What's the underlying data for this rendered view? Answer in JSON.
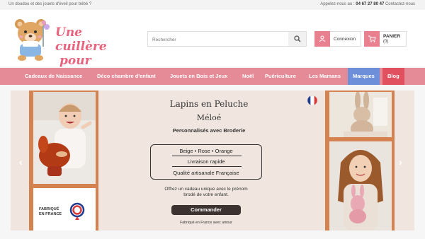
{
  "topbar": {
    "tagline": "Un doudou et des jouets d'éveil pour bébé ?",
    "call_label": "Appelez-nous au :",
    "phone": "04 67 27 80 47",
    "contact": "Contactez-nous"
  },
  "logo": {
    "line1": "Une cuillère",
    "line2": "pour doudou !"
  },
  "search": {
    "placeholder": "Rechercher",
    "icon": "search-icon"
  },
  "login": {
    "label": "Connexion",
    "icon": "user-icon"
  },
  "cart": {
    "label": "PANIER",
    "count": "(0)",
    "icon": "cart-icon"
  },
  "nav": {
    "items": [
      {
        "label": "Cadeaux de Naissance"
      },
      {
        "label": "Déco chambre d'enfant"
      },
      {
        "label": "Jouets en Bois et Jeux"
      },
      {
        "label": "Noël"
      },
      {
        "label": "Puériculture"
      },
      {
        "label": "Les Mamans"
      },
      {
        "label": "Marques"
      },
      {
        "label": "Blog"
      }
    ]
  },
  "hero": {
    "title": "Lapins en Peluche",
    "subtitle": "Méloé",
    "tagline": "Personnalisés avec Broderie",
    "features": [
      "Beige • Rose • Orange",
      "Livraison rapide",
      "Qualité artisanale Française"
    ],
    "desc_line1": "Offrez un cadeau unique avec le prénom",
    "desc_line2": "brodé de votre enfant.",
    "cta": "Commander",
    "footer": "Fabriqué en France avec amour",
    "badge_line1": "FABRIQUÉ",
    "badge_line2": "EN FRANCE",
    "prev": "‹",
    "next": "›"
  },
  "colors": {
    "accent": "#e8808f",
    "nav": "#e58a97",
    "marques": "#6d8fd9",
    "blog": "#e0505f",
    "logo_text": "#e8637d"
  }
}
